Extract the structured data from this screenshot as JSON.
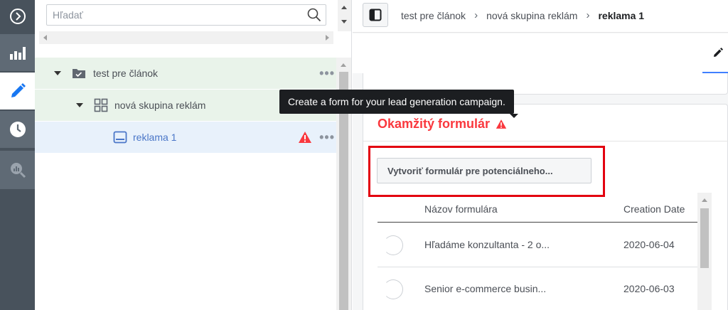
{
  "nav": {
    "items": [
      {
        "icon": "chevron-right-circle-icon"
      },
      {
        "icon": "bar-chart-icon"
      },
      {
        "icon": "pencil-icon"
      },
      {
        "icon": "clock-icon"
      },
      {
        "icon": "search-chart-icon"
      }
    ]
  },
  "tree": {
    "search_placeholder": "Hľadať",
    "rows": [
      {
        "label": "test pre článok",
        "icon": "campaign-folder-icon"
      },
      {
        "label": "nová skupina reklám",
        "icon": "ad-set-grid-icon"
      },
      {
        "label": "reklama 1",
        "icon": "ad-icon",
        "warning": true
      }
    ],
    "more_glyph": "•••"
  },
  "breadcrumb": {
    "items": [
      "test pre článok",
      "nová skupina reklám"
    ],
    "current": "reklama 1",
    "separator": "›"
  },
  "tooltip": {
    "text": "Create a form for your lead generation campaign."
  },
  "section": {
    "title": "Okamžitý formulár",
    "create_button": "Vytvoriť formulár pre potenciálneho...",
    "table": {
      "columns": [
        "Názov formulára",
        "Creation Date"
      ],
      "rows": [
        {
          "name": "Hľadáme konzultanta - 2 o...",
          "date": "2020-06-04"
        },
        {
          "name": "Senior e-commerce busin...",
          "date": "2020-06-03"
        }
      ]
    }
  },
  "colors": {
    "accent": "#4080ff",
    "error": "#fa383e",
    "highlight": "#e3000f",
    "rail": "#48525c"
  }
}
